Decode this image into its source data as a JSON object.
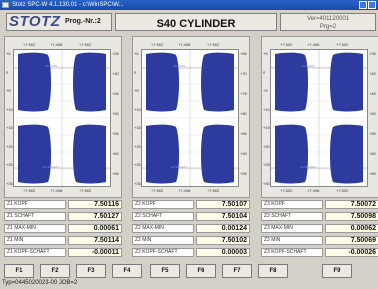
{
  "window": {
    "title": "Stotz SPC-W 4.1.130.01 - c:\\WinSPC\\W..."
  },
  "header": {
    "logo": "STOTZ",
    "prog_label": "Prog.-Nr.:2",
    "type_title": "S40 CYLINDER",
    "ver_line1": "Ver=401120001",
    "ver_line2": "Prg=2"
  },
  "panels": [
    {
      "x_ticks_top": [
        "+7.502",
        "+7.498",
        "+7.502"
      ],
      "x_ticks_bottom": [
        "+7.502",
        "+7.498",
        "+7.502"
      ],
      "y_left": [
        "+5",
        "0",
        "+5",
        "+10",
        "+15",
        "+20",
        "+25",
        "+30"
      ],
      "y_right": [
        "+35",
        "+40",
        "+45",
        "+50",
        "+55",
        "+60",
        "+65"
      ],
      "mark_top": "Z1 KOPF",
      "mark_bottom": "Z1 SCHAFT",
      "measurements": [
        {
          "label": "Z1 KOPF",
          "value": "7.50116"
        },
        {
          "label": "Z1 SCHAFT",
          "value": "7.50127"
        },
        {
          "label": "Z1 MAX-MIN",
          "value": "0.00061"
        },
        {
          "label": "Z1 MIN",
          "value": "7.50114"
        },
        {
          "label": "Z1 KOPF-SCHAFT",
          "value": "-0.00011"
        }
      ]
    },
    {
      "x_ticks_top": [
        "+7.502",
        "+7.498",
        "+7.502"
      ],
      "x_ticks_bottom": [
        "+7.502",
        "+7.498",
        "+7.502"
      ],
      "y_left": [
        "+5",
        "0",
        "+5",
        "+10",
        "+15",
        "+20",
        "+25",
        "+30"
      ],
      "y_right": [
        "+65",
        "+70",
        "+75",
        "+80",
        "+85",
        "+90",
        "+95"
      ],
      "mark_top": "Z2 KOPF",
      "mark_bottom": "Z2 SCHAFT",
      "measurements": [
        {
          "label": "Z2 KOPF",
          "value": "7.50107"
        },
        {
          "label": "Z2 SCHAFT",
          "value": "7.50104"
        },
        {
          "label": "Z2 MAX-MIN",
          "value": "0.00124"
        },
        {
          "label": "Z2 MIN",
          "value": "7.50102"
        },
        {
          "label": "Z2 KOPF-SCHAFT",
          "value": "0.00003"
        }
      ]
    },
    {
      "x_ticks_top": [
        "+7.502",
        "+7.498",
        "+7.502"
      ],
      "x_ticks_bottom": [
        "+7.502",
        "+7.498",
        "+7.502"
      ],
      "y_left": [
        "+5",
        "0",
        "+5",
        "+10",
        "+15",
        "+20",
        "+25",
        "+30"
      ],
      "y_right": [
        "+35",
        "+40",
        "+45",
        "+50",
        "+55",
        "+60",
        "+65"
      ],
      "mark_top": "Z3 KOPF",
      "mark_bottom": "Z3 SCHAFT",
      "measurements": [
        {
          "label": "Z3 KOPF",
          "value": "7.50072"
        },
        {
          "label": "Z3 SCHAFT",
          "value": "7.50098"
        },
        {
          "label": "Z3 MAX-MIN",
          "value": "0.00062"
        },
        {
          "label": "Z3 MIN",
          "value": "7.50069"
        },
        {
          "label": "Z3 KOPF-SCHAFT",
          "value": "-0.00026"
        }
      ]
    }
  ],
  "function_keys": [
    "F1",
    "F2",
    "F3",
    "F4",
    "F5",
    "F6",
    "F7",
    "F8",
    "F9"
  ],
  "status": "Typ=0445020023-00 JOB=2",
  "colors": {
    "profile_fill": "#2d3a9e",
    "titlebar": "#2a62c8",
    "value_bg": "#fffde8"
  }
}
